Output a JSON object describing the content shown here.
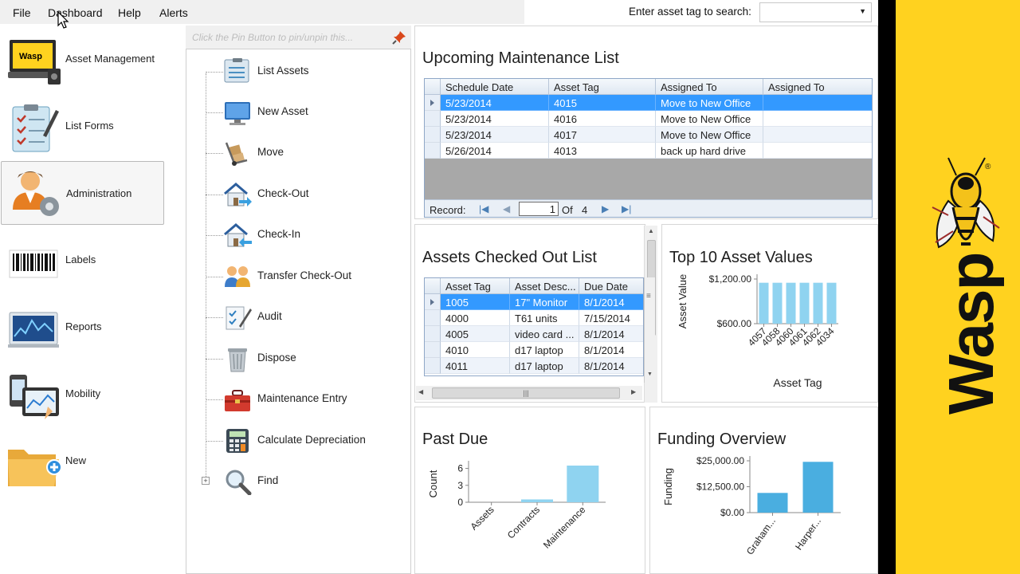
{
  "menu": {
    "file": "File",
    "dashboard": "Dashboard",
    "help": "Help",
    "alerts": "Alerts"
  },
  "search": {
    "label": "Enter asset tag to search:",
    "value": ""
  },
  "nav": [
    {
      "label": "Asset Management",
      "icon": "laptop-wasp-icon"
    },
    {
      "label": "List Forms",
      "icon": "clipboard-checklist-icon"
    },
    {
      "label": "Administration",
      "icon": "admin-user-gear-icon",
      "selected": true
    },
    {
      "label": "Labels",
      "icon": "barcode-icon"
    },
    {
      "label": "Reports",
      "icon": "chart-monitor-icon"
    },
    {
      "label": "Mobility",
      "icon": "mobile-devices-icon"
    },
    {
      "label": "New",
      "icon": "folder-add-icon"
    }
  ],
  "tree": {
    "pin_text": "Click the Pin Button to pin/unpin this...",
    "items": [
      {
        "label": "List Assets",
        "icon": "list-assets-icon"
      },
      {
        "label": "New Asset",
        "icon": "monitor-icon"
      },
      {
        "label": "Move",
        "icon": "hand-truck-icon"
      },
      {
        "label": "Check-Out",
        "icon": "house-arrow-out-icon"
      },
      {
        "label": "Check-In",
        "icon": "house-arrow-in-icon"
      },
      {
        "label": "Transfer Check-Out",
        "icon": "transfer-users-icon"
      },
      {
        "label": "Audit",
        "icon": "audit-pen-icon"
      },
      {
        "label": "Dispose",
        "icon": "trash-can-icon"
      },
      {
        "label": "Maintenance Entry",
        "icon": "toolbox-icon"
      },
      {
        "label": "Calculate Depreciation",
        "icon": "calculator-icon"
      },
      {
        "label": "Find",
        "icon": "magnifier-icon"
      }
    ]
  },
  "maintenance": {
    "title": "Upcoming Maintenance List",
    "columns": [
      "Schedule Date",
      "Asset Tag",
      "Assigned To",
      "Assigned To"
    ],
    "rows": [
      [
        "5/23/2014",
        "4015",
        "Move to New Office",
        ""
      ],
      [
        "5/23/2014",
        "4016",
        "Move to New Office",
        ""
      ],
      [
        "5/23/2014",
        "4017",
        "Move to New Office",
        ""
      ],
      [
        "5/26/2014",
        "4013",
        "back up hard drive",
        ""
      ]
    ],
    "navigator": {
      "label": "Record:",
      "current": "1",
      "of": "Of",
      "total": "4"
    }
  },
  "checked_out": {
    "title": "Assets Checked Out List",
    "columns": [
      "Asset Tag",
      "Asset Desc...",
      "Due Date"
    ],
    "rows": [
      [
        "1005",
        "17\" Monitor",
        "8/1/2014"
      ],
      [
        "4000",
        "T61 units",
        "7/15/2014"
      ],
      [
        "4005",
        "video card ...",
        "8/1/2014"
      ],
      [
        "4010",
        "d17 laptop",
        "8/1/2014"
      ],
      [
        "4011",
        "d17 laptop",
        "8/1/2014"
      ]
    ]
  },
  "top10": {
    "title": "Top 10 Asset Values"
  },
  "past_due": {
    "title": "Past Due"
  },
  "funding": {
    "title": "Funding Overview"
  },
  "chart_data": [
    {
      "type": "bar",
      "title": "Top 10 Asset Values",
      "xlabel": "Asset Tag",
      "ylabel": "Asset Value",
      "categories": [
        "4057",
        "4058",
        "4060",
        "4061",
        "4062",
        "4034"
      ],
      "values": [
        1150,
        1150,
        1150,
        1150,
        1150,
        1150
      ],
      "ytick_labels": [
        "$600.00",
        "$1,200.00"
      ],
      "yticks": [
        600,
        1200
      ],
      "ylim": [
        600,
        1200
      ],
      "color": "#8fd3f0",
      "grid": false
    },
    {
      "type": "bar",
      "title": "Past Due",
      "xlabel": "",
      "ylabel": "Count",
      "categories": [
        "Assets",
        "Contracts",
        "Maintenance"
      ],
      "values": [
        0,
        0.5,
        6.5
      ],
      "yticks": [
        0,
        3,
        6
      ],
      "ylim": [
        0,
        6.5
      ],
      "color": "#8fd3f0",
      "grid": false
    },
    {
      "type": "bar",
      "title": "Funding Overview",
      "xlabel": "",
      "ylabel": "Funding",
      "categories": [
        "Graham...",
        "Harper..."
      ],
      "values": [
        9500,
        24500
      ],
      "ytick_labels": [
        "$0.00",
        "$12,500.00",
        "$25,000.00"
      ],
      "yticks": [
        0,
        12500,
        25000
      ],
      "ylim": [
        0,
        25000
      ],
      "color": "#4aaee0",
      "grid": false
    }
  ],
  "brand": {
    "name": "Wasp",
    "yellow": "#ffd21f",
    "registered": "®"
  }
}
